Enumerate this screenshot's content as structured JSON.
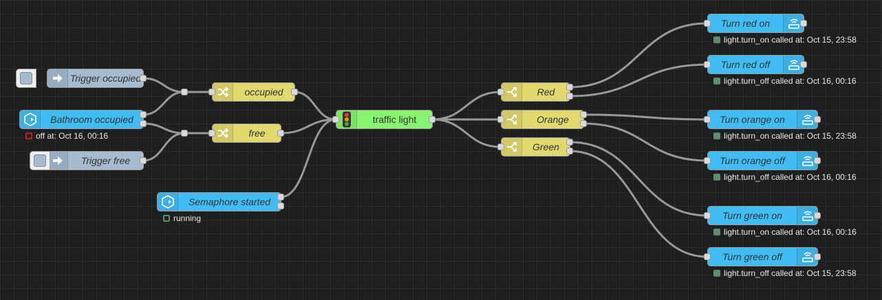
{
  "nodes": {
    "trigger_occupied": "Trigger occupied",
    "bathroom_occupied": "Bathroom occupied",
    "trigger_free": "Trigger free",
    "semaphore_started": "Semaphore started",
    "occupied": "occupied",
    "free": "free",
    "traffic_light": "traffic light",
    "red": "Red",
    "orange": "Orange",
    "green": "Green",
    "turn_red_on": "Turn red on",
    "turn_red_off": "Turn red off",
    "turn_orange_on": "Turn orange on",
    "turn_orange_off": "Turn orange off",
    "turn_green_on": "Turn green on",
    "turn_green_off": "Turn green off"
  },
  "status": {
    "bathroom_occupied": "off at: Oct 16, 00:16",
    "semaphore_started": "running",
    "turn_red_on": "light.turn_on called at: Oct 15, 23:58",
    "turn_red_off": "light.turn_off called at: Oct 16, 00:16",
    "turn_orange_on": "light.turn_on called at: Oct 15, 23:58",
    "turn_orange_off": "light.turn_off called at: Oct 16, 00:16",
    "turn_green_on": "light.turn_on called at: Oct 16, 00:16",
    "turn_green_off": "light.turn_off called at: Oct 15, 23:58"
  },
  "colors": {
    "canvas": "#1f1f1f",
    "wire": "#999999",
    "home_assistant_node": "#41bdf5",
    "inject_node": "#a6bbcf",
    "switch_node": "#e2d96e",
    "traffic_light_node": "#87f56f",
    "status_green": "#5a8f6a",
    "status_red": "#c02020"
  }
}
